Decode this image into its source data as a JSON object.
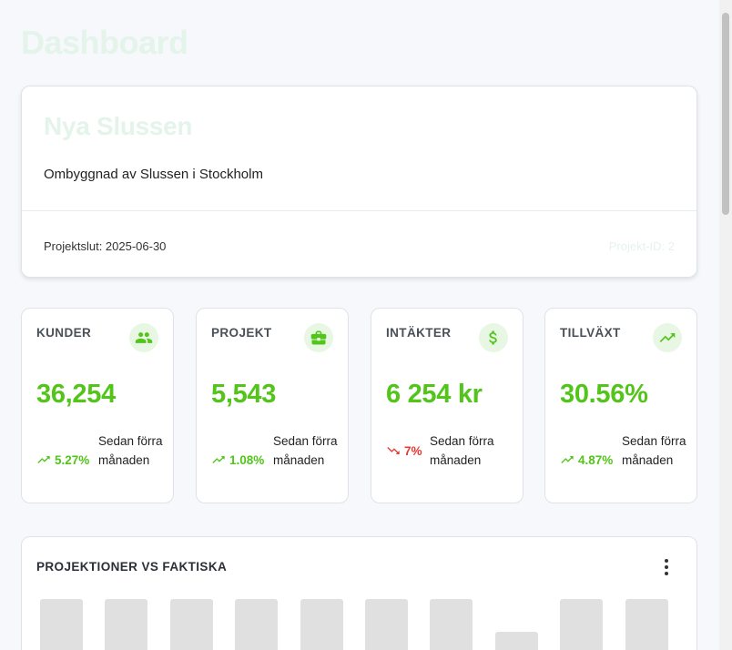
{
  "page": {
    "title": "Dashboard"
  },
  "project": {
    "name": "Nya Slussen",
    "description": "Ombyggnad av Slussen i Stockholm",
    "end_label": "Projektslut: 2025-06-30",
    "id_label": "Projekt-ID: 2"
  },
  "stats": [
    {
      "title": "KUNDER",
      "icon": "users-icon",
      "value": "36,254",
      "change": "5.27%",
      "trend": "up",
      "note": "Sedan förra månaden"
    },
    {
      "title": "PROJEKT",
      "icon": "briefcase-icon",
      "value": "5,543",
      "change": "1.08%",
      "trend": "up",
      "note": "Sedan förra månaden"
    },
    {
      "title": "INTÄKTER",
      "icon": "dollar-icon",
      "value": "6 254 kr",
      "change": "7%",
      "trend": "down",
      "note": "Sedan förra månaden"
    },
    {
      "title": "TILLVÄXT",
      "icon": "trending-up-icon",
      "value": "30.56%",
      "change": "4.87%",
      "trend": "up",
      "note": "Sedan förra månaden"
    }
  ],
  "chart": {
    "title": "PROJEKTIONER VS FAKTISKA",
    "menu_icon": "more-vertical-icon"
  },
  "chart_data": {
    "type": "bar",
    "title": "PROJEKTIONER VS FAKTISKA",
    "state": "loading-skeleton",
    "values": [
      48,
      48,
      48,
      48,
      48,
      48,
      48,
      24,
      48,
      48
    ]
  },
  "colors": {
    "accent": "#52c41a",
    "negative": "#e53935",
    "icon_bg": "#e8f7e4",
    "faded_title": "#e4f4ea",
    "skeleton": "#e0e0e0"
  }
}
